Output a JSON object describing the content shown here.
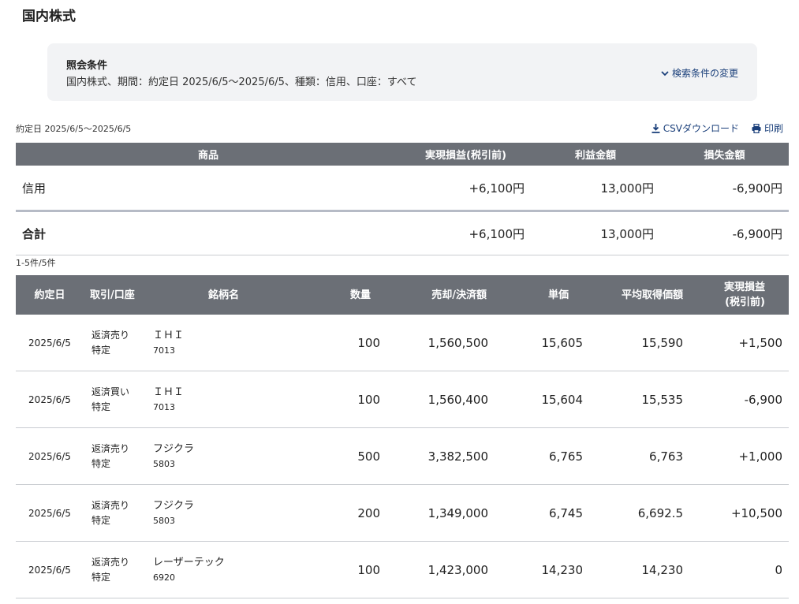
{
  "page": {
    "title": "国内株式"
  },
  "criteria": {
    "heading": "照会条件",
    "summary": "国内株式、期間：約定日 2025/6/5〜2025/6/5、種類：信用、口座：すべて",
    "change_label": "検索条件の変更"
  },
  "period_text": "約定日 2025/6/5〜2025/6/5",
  "links": {
    "csv": "CSVダウンロード",
    "print": "印刷"
  },
  "summary_table": {
    "headers": [
      "商品",
      "実現損益(税引前)",
      "利益金額",
      "損失金額"
    ],
    "row": {
      "label": "信用",
      "realized": "+6,100円",
      "profit": "13,000円",
      "loss": "-6,900円"
    },
    "total": {
      "label": "合計",
      "realized": "+6,100円",
      "profit": "13,000円",
      "loss": "-6,900円"
    }
  },
  "count_text": "1-5件/5件",
  "detail_table": {
    "headers": {
      "date": "約定日",
      "trade": "取引/口座",
      "name": "銘柄名",
      "qty": "数量",
      "amount": "売却/決済額",
      "price": "単価",
      "avg": "平均取得価額",
      "pl_line1": "実現損益",
      "pl_line2": "(税引前)"
    },
    "rows": [
      {
        "date": "2025/6/5",
        "trade": "返済売り",
        "account": "特定",
        "name": "ＩＨＩ",
        "code": "7013",
        "qty": "100",
        "amount": "1,560,500",
        "price": "15,605",
        "avg": "15,590",
        "pl": "+1,500"
      },
      {
        "date": "2025/6/5",
        "trade": "返済買い",
        "account": "特定",
        "name": "ＩＨＩ",
        "code": "7013",
        "qty": "100",
        "amount": "1,560,400",
        "price": "15,604",
        "avg": "15,535",
        "pl": "-6,900"
      },
      {
        "date": "2025/6/5",
        "trade": "返済売り",
        "account": "特定",
        "name": "フジクラ",
        "code": "5803",
        "qty": "500",
        "amount": "3,382,500",
        "price": "6,765",
        "avg": "6,763",
        "pl": "+1,000"
      },
      {
        "date": "2025/6/5",
        "trade": "返済売り",
        "account": "特定",
        "name": "フジクラ",
        "code": "5803",
        "qty": "200",
        "amount": "1,349,000",
        "price": "6,745",
        "avg": "6,692.5",
        "pl": "+10,500"
      },
      {
        "date": "2025/6/5",
        "trade": "返済売り",
        "account": "特定",
        "name": "レーザーテック",
        "code": "6920",
        "qty": "100",
        "amount": "1,423,000",
        "price": "14,230",
        "avg": "14,230",
        "pl": "0"
      }
    ]
  },
  "colors": {
    "positive": "#d4145a",
    "negative": "#1e8a7a",
    "header_bg": "#6b6f76",
    "link": "#1a3f7a"
  }
}
